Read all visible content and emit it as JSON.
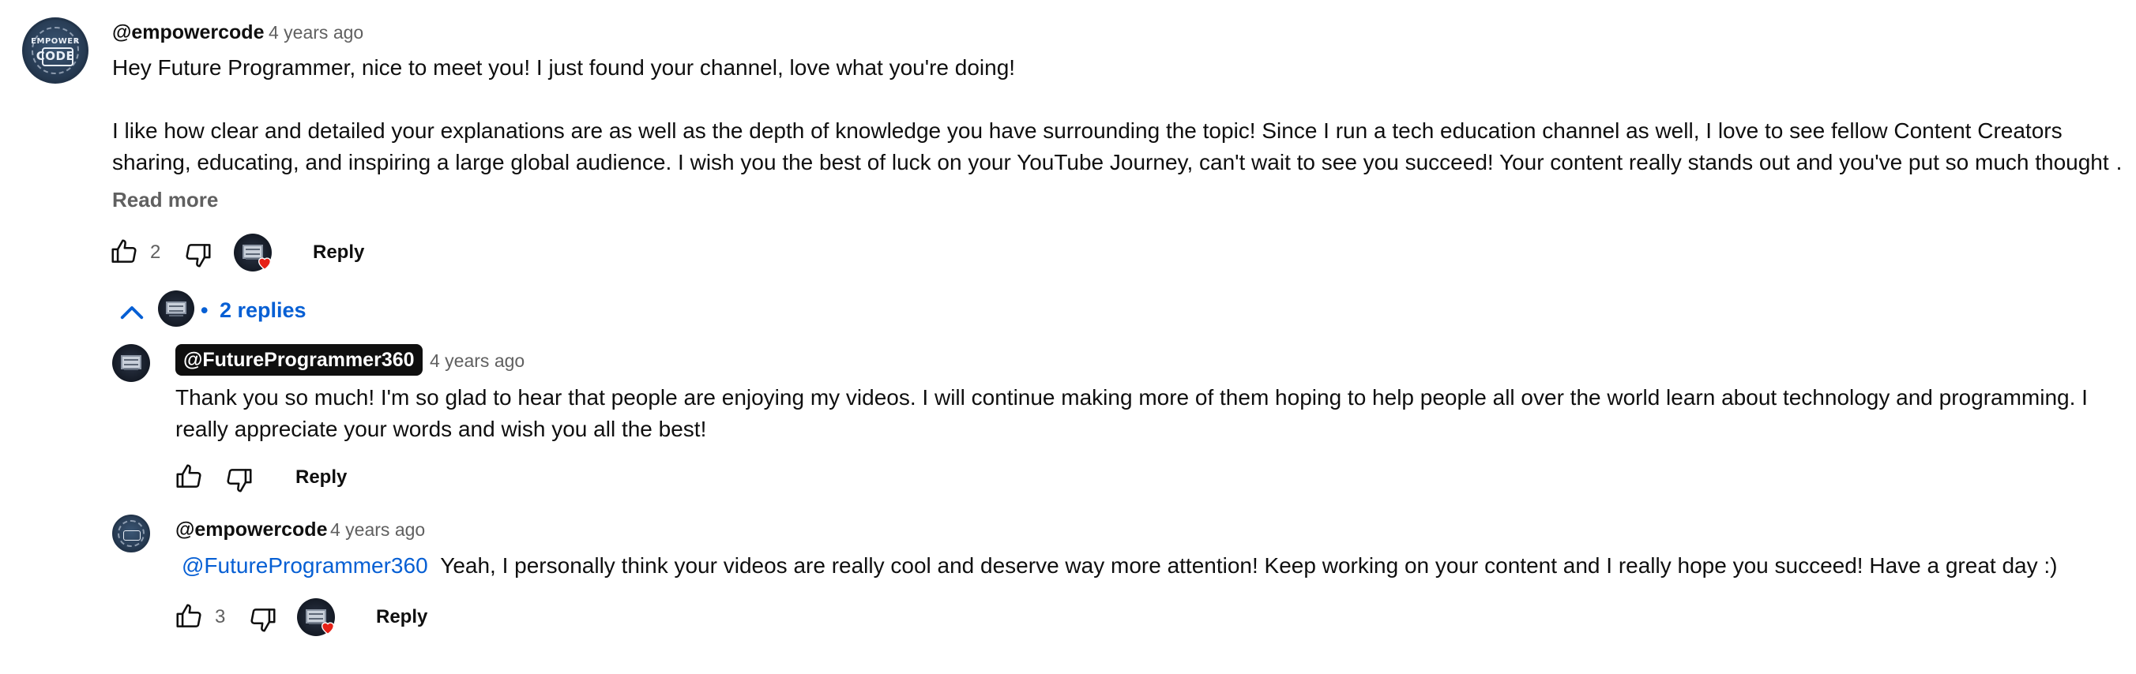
{
  "comment": {
    "author": "@empowercode",
    "time": "4 years ago",
    "paragraph1": "Hey Future Programmer, nice to meet you! I just found your channel, love what you're doing!",
    "paragraph2_line1": "I like how clear and detailed your explanations are as well as the depth of knowledge you have surrounding the topic! Since I run a tech education channel as well, I love to see fellow Content Creators",
    "paragraph2_line2": "sharing, educating, and inspiring a large global audience. I wish you the best of luck on your YouTube Journey, can't wait to see you succeed! Your content really stands out and you've put so much thought …",
    "read_more": "Read more",
    "like_count": "2",
    "reply_label": "Reply",
    "avatar_text_top": "EMPOWER",
    "avatar_text_bottom": "CODE"
  },
  "replies_toggle": {
    "label": "2 replies",
    "bullet": "•"
  },
  "replies": [
    {
      "author": "@FutureProgrammer360",
      "time": "4 years ago",
      "text_line1": "Thank you so much! I'm so glad to hear that people are enjoying my videos. I will continue making more of them hoping to help people all over the world learn about technology and programming. I",
      "text_line2": "really appreciate your words and wish you all the best!",
      "reply_label": "Reply"
    },
    {
      "author": "@empowercode",
      "time": "4 years ago",
      "mention": "@FutureProgrammer360",
      "text": "Yeah, I personally think your videos are really cool and deserve way more attention! Keep working on your content and I really hope you succeed! Have a great day :)",
      "like_count": "3",
      "reply_label": "Reply"
    }
  ],
  "colors": {
    "link": "#065fd4",
    "heart": "#e62117",
    "muted": "#606060"
  }
}
